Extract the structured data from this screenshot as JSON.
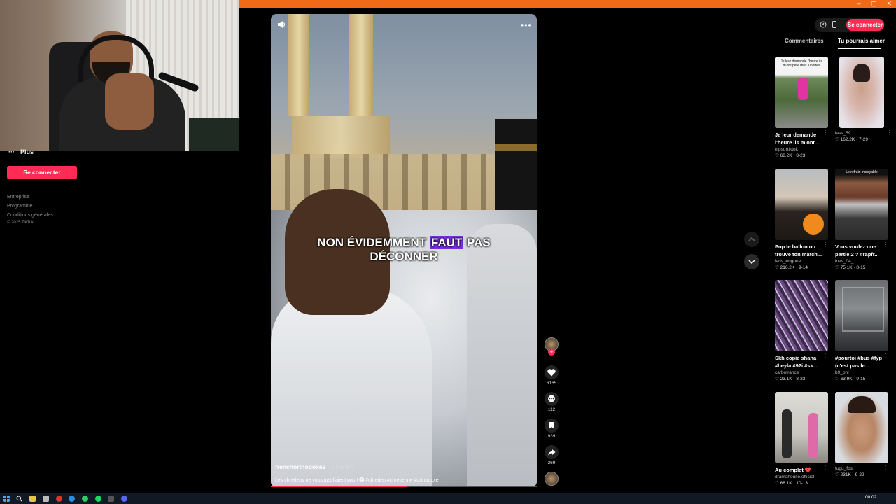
{
  "window": {
    "minimize": "–",
    "maximize": "▢",
    "close": "✕"
  },
  "sidebar": {
    "more_label": "Plus",
    "login_button": "Se connecter",
    "footer_links": [
      "Entreprise",
      "Programme",
      "Conditions générales"
    ],
    "copyright": "© 2025 TikTok"
  },
  "video": {
    "caption_part1": "NON ÉVIDEMMENT",
    "caption_highlight": "FAUT",
    "caption_part2": "PAS",
    "caption_line2": "DÉCONNER",
    "author": "frenchorthodoxe2",
    "time_ago": "· Il y a 6 h",
    "description": "Les chrétiens ne vous justifiaient pas ! 🅔 #chretien #chrétienne #orthodoxe",
    "progress": 0.51
  },
  "actions": {
    "likes": "6165",
    "comments": "112",
    "saves": "939",
    "shares": "269"
  },
  "right_panel": {
    "login_button": "Se connecter",
    "tabs": [
      "Commentaires",
      "Tu pourrais aimer"
    ],
    "active_tab": "Tu pourrais aimer",
    "cards": [
      {
        "title": "Je leur demande l'heure ils m'ont...",
        "author": "nlpsurtiktok",
        "stats": "♡ 68.2K · 8-23",
        "overlay": "Je leur demande l'heure ils m'ont pete mes lunettes"
      },
      {
        "title": "",
        "author": "lass_59",
        "stats": "♡ 162.2K · 7-29",
        "overlay": ""
      },
      {
        "title": "Pop le ballon ou trouve ton match...",
        "author": "laris_engone",
        "stats": "♡ 216.2K · 9-14",
        "overlay": ""
      },
      {
        "title": "Vous voulez une partie 2 ? #rapfr...",
        "author": "ines_04_",
        "stats": "♡ 75.1K · 8-15",
        "overlay": "Le refrain incroyable"
      },
      {
        "title": "Skh copie shana #heyla #92i #sk...",
        "author": "carbofrance",
        "stats": "♡ 23.1K · 8-23",
        "overlay": ""
      },
      {
        "title": "#pourtoi #bus #fyp (c'est pas le...",
        "author": "b9_bnl",
        "stats": "♡ 63.9K · 9-15",
        "overlay": ""
      },
      {
        "title": "Au complet ❤️",
        "author": "dramahouse.officiel",
        "stats": "♡ 68.1K · 10-13",
        "overlay": ""
      },
      {
        "title": "",
        "author": "fugu_fps",
        "stats": "♡ 231K · 9-22",
        "overlay": ""
      }
    ]
  },
  "taskbar": {
    "time": "00:02"
  },
  "colors": {
    "accent": "#fe2c55",
    "topbar": "#f06a17"
  }
}
